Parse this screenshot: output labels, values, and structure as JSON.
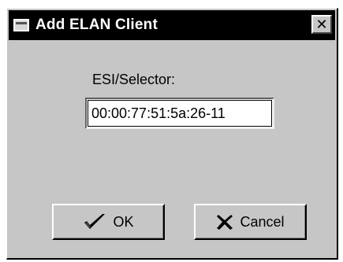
{
  "window": {
    "title": "Add ELAN Client",
    "close_glyph": "✕"
  },
  "form": {
    "esi_label": "ESI/Selector:",
    "esi_value": "00:00:77:51:5a:26-11"
  },
  "buttons": {
    "ok_label": "OK",
    "ok_icon": "check-icon",
    "cancel_label": "Cancel",
    "cancel_icon": "x-icon"
  }
}
